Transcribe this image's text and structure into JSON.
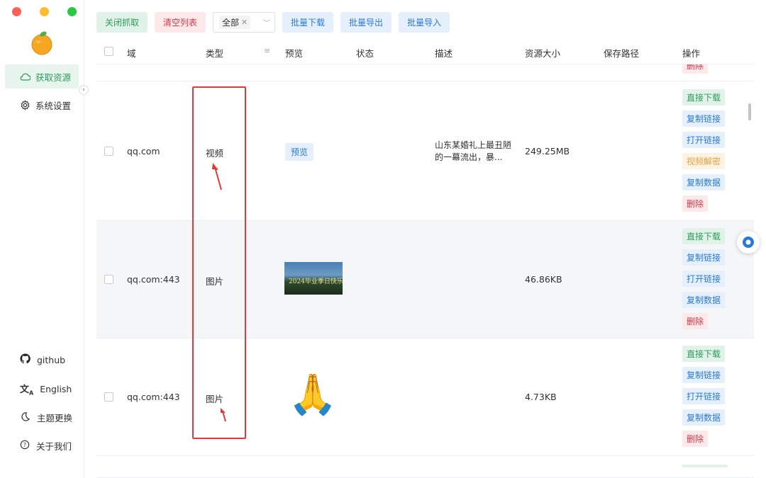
{
  "sidebar": {
    "nav": [
      {
        "label": "获取资源",
        "icon": "cloud-icon",
        "active": true
      },
      {
        "label": "系统设置",
        "icon": "gear-icon",
        "active": false
      }
    ],
    "bottom": [
      {
        "label": "github",
        "icon": "github-icon"
      },
      {
        "label": "English",
        "icon": "translate-icon"
      },
      {
        "label": "主题更换",
        "icon": "moon-icon"
      },
      {
        "label": "关于我们",
        "icon": "help-icon"
      }
    ]
  },
  "toolbar": {
    "close_capture": "关闭抓取",
    "clear_list": "清空列表",
    "filter_value": "全部",
    "batch_download": "批量下载",
    "batch_export": "批量导出",
    "batch_import": "批量导入"
  },
  "table": {
    "headers": {
      "domain": "域",
      "type": "类型",
      "preview": "预览",
      "status": "状态",
      "description": "描述",
      "size": "资源大小",
      "save_path": "保存路径",
      "actions": "操作"
    },
    "partial_top_action": "删除",
    "rows": [
      {
        "domain": "qq.com",
        "type": "视频",
        "preview_label": "预览",
        "description": "山东某婚礼上最丑陋的一幕流出，暴...",
        "size": "249.25MB",
        "actions": [
          "直接下载",
          "复制链接",
          "打开链接",
          "视频解密",
          "复制数据",
          "删除"
        ]
      },
      {
        "domain": "qq.com:443",
        "type": "图片",
        "thumb_text": "2024毕业季日快乐",
        "description": "",
        "size": "46.86KB",
        "actions": [
          "直接下载",
          "复制链接",
          "打开链接",
          "复制数据",
          "删除"
        ]
      },
      {
        "domain": "qq.com:443",
        "type": "图片",
        "preview_emoji": "🙏",
        "description": "",
        "size": "4.73KB",
        "actions": [
          "直接下载",
          "复制链接",
          "打开链接",
          "复制数据",
          "删除"
        ]
      }
    ]
  },
  "colors": {
    "accent_green": "#2e9a5b",
    "link_blue": "#2a79d8",
    "danger_red": "#d0394b",
    "warning_orange": "#e6a23c",
    "highlight_red": "#e53935"
  }
}
